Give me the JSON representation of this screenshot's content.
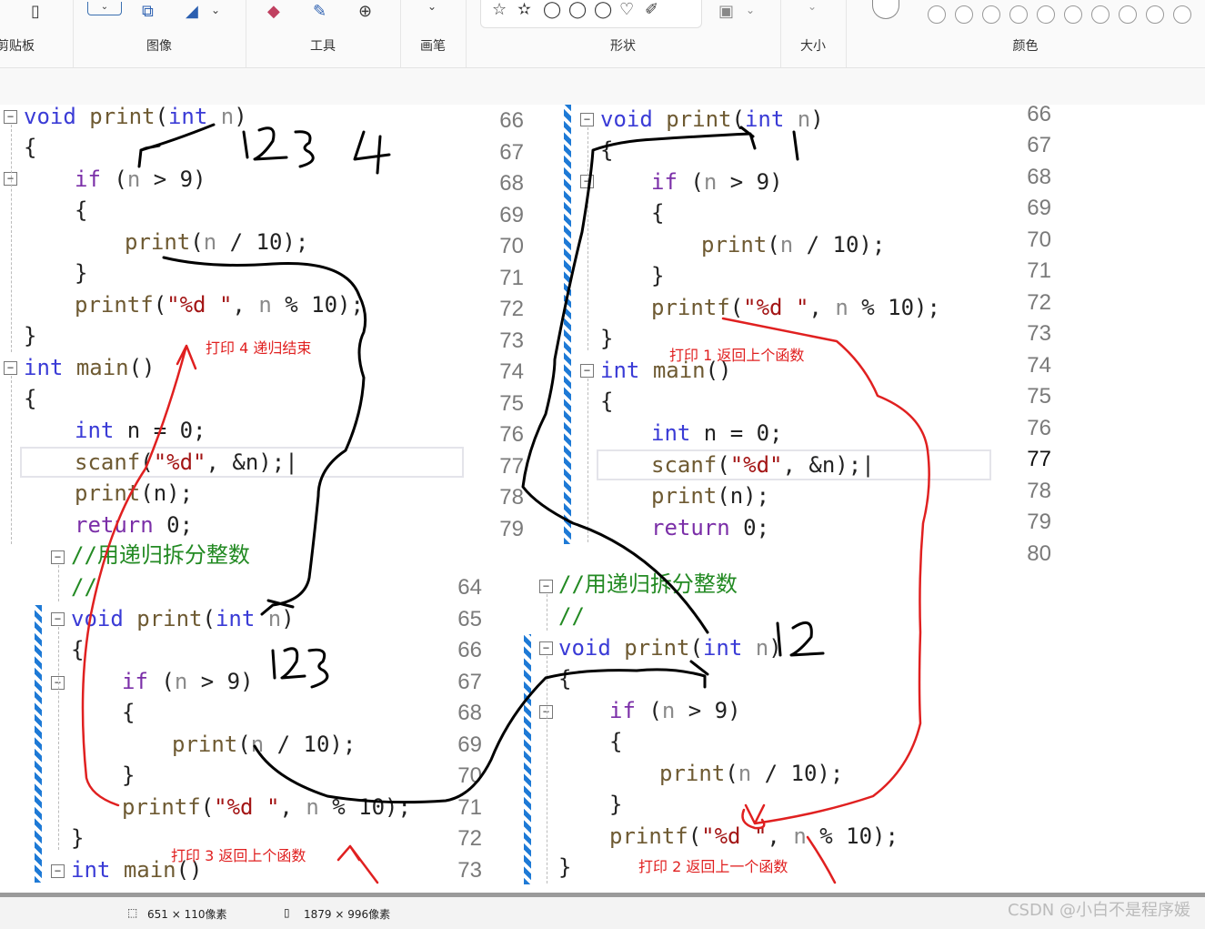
{
  "ribbon": {
    "groups": [
      "剪贴板",
      "图像",
      "工具",
      "画笔",
      "形状",
      "大小",
      "颜色"
    ],
    "shape_icons": [
      "☆",
      "✫",
      "◯",
      "◯",
      "◯",
      "♡",
      "✐"
    ]
  },
  "code": {
    "keyword_void": "void",
    "keyword_int": "int",
    "keyword_if": "if",
    "keyword_return": "return",
    "print": "print",
    "printf": "printf",
    "scanf": "scanf",
    "main": "main",
    "comment": "//用递归拆分整数",
    "comment2": "//",
    "fmt": "\"%d \"",
    "fmt2": "\"%d\""
  },
  "panels": {
    "top_left_lines": [
      "66",
      "67",
      "68",
      "69",
      "70",
      "71",
      "72",
      "73",
      "74",
      "75",
      "76",
      "77",
      "78",
      "79"
    ],
    "top_right_lines": [
      "66",
      "67",
      "68",
      "69",
      "70",
      "71",
      "72",
      "73",
      "74",
      "75",
      "76",
      "77",
      "78",
      "79",
      "80"
    ],
    "bottom_left_lines": [
      "64",
      "65",
      "66",
      "67",
      "68",
      "69",
      "70",
      "71",
      "72",
      "73"
    ]
  },
  "annotations": {
    "a1": "打印 4 递归结束",
    "a2": "打印 1 返回上个函数",
    "a3": "打印 3 返回上个函数",
    "a4": "打印 2 返回上一个函数"
  },
  "status": {
    "selection": "651 × 110像素",
    "image_size": "1879 × 996像素"
  },
  "watermark": "CSDN @小白不是程序媛"
}
